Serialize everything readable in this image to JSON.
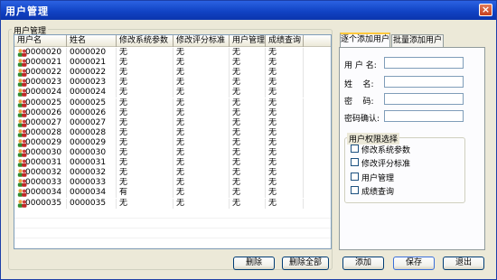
{
  "window": {
    "title": "用户管理",
    "close_label": "×"
  },
  "user_list": {
    "group_label": "用户管理",
    "columns": [
      "用户名",
      "姓名",
      "修改系统参数",
      "修改评分标准",
      "用户管理",
      "成绩查询"
    ],
    "rows": [
      {
        "username": "0000020",
        "name": "0000020",
        "sys": "无",
        "score": "无",
        "user": "无",
        "query": "无"
      },
      {
        "username": "0000021",
        "name": "0000021",
        "sys": "无",
        "score": "无",
        "user": "无",
        "query": "无"
      },
      {
        "username": "0000022",
        "name": "0000022",
        "sys": "无",
        "score": "无",
        "user": "无",
        "query": "无"
      },
      {
        "username": "0000023",
        "name": "0000023",
        "sys": "无",
        "score": "无",
        "user": "无",
        "query": "无"
      },
      {
        "username": "0000024",
        "name": "0000024",
        "sys": "无",
        "score": "无",
        "user": "无",
        "query": "无"
      },
      {
        "username": "0000025",
        "name": "0000025",
        "sys": "无",
        "score": "无",
        "user": "无",
        "query": "无"
      },
      {
        "username": "0000026",
        "name": "0000026",
        "sys": "无",
        "score": "无",
        "user": "无",
        "query": "无"
      },
      {
        "username": "0000027",
        "name": "0000027",
        "sys": "无",
        "score": "无",
        "user": "无",
        "query": "无"
      },
      {
        "username": "0000028",
        "name": "0000028",
        "sys": "无",
        "score": "无",
        "user": "无",
        "query": "无"
      },
      {
        "username": "0000029",
        "name": "0000029",
        "sys": "无",
        "score": "无",
        "user": "无",
        "query": "无"
      },
      {
        "username": "0000030",
        "name": "0000030",
        "sys": "无",
        "score": "无",
        "user": "无",
        "query": "无"
      },
      {
        "username": "0000031",
        "name": "0000031",
        "sys": "无",
        "score": "无",
        "user": "无",
        "query": "无"
      },
      {
        "username": "0000032",
        "name": "0000032",
        "sys": "无",
        "score": "无",
        "user": "无",
        "query": "无"
      },
      {
        "username": "0000033",
        "name": "0000033",
        "sys": "无",
        "score": "无",
        "user": "无",
        "query": "无"
      },
      {
        "username": "0000034",
        "name": "0000034",
        "sys": "有",
        "score": "无",
        "user": "无",
        "query": "无"
      },
      {
        "username": "0000035",
        "name": "0000035",
        "sys": "无",
        "score": "无",
        "user": "无",
        "query": "无"
      }
    ],
    "delete_label": "删除",
    "delete_all_label": "删除全部"
  },
  "tabs": {
    "single": "逐个添加用户",
    "batch": "批量添加用户"
  },
  "form": {
    "username_label": "用 户 名:",
    "name_label": "姓    名:",
    "password_label": "密    码:",
    "confirm_label": "密码确认:",
    "username_value": "",
    "name_value": "",
    "password_value": "",
    "confirm_value": ""
  },
  "permissions": {
    "group_label": "用户权限选择",
    "items": [
      "修改系统参数",
      "修改评分标准",
      "用户管理",
      "成绩查询"
    ]
  },
  "actions": {
    "add": "添加",
    "save": "保存",
    "exit": "退出"
  },
  "icons": {
    "user_icon": "user-group-icon"
  },
  "colors": {
    "title_bar": "#1143c4",
    "window_bg": "#ece9d8",
    "tab_highlight": "#ffc83c"
  }
}
